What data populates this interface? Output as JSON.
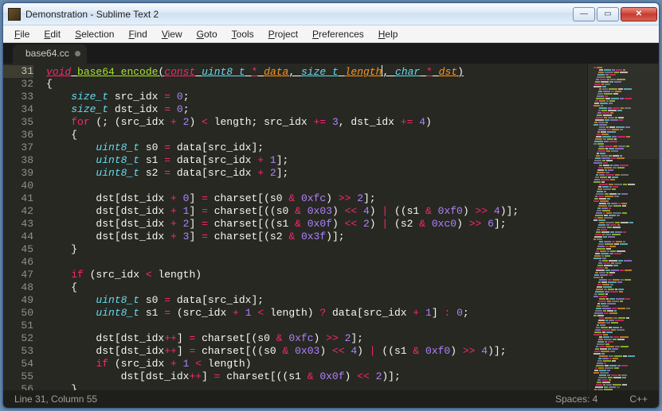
{
  "window": {
    "title": "Demonstration - Sublime Text 2"
  },
  "win_buttons": {
    "min": "—",
    "max": "▭",
    "close": "✕"
  },
  "menu": [
    "File",
    "Edit",
    "Selection",
    "Find",
    "View",
    "Goto",
    "Tools",
    "Project",
    "Preferences",
    "Help"
  ],
  "tab": {
    "label": "base64.cc",
    "modified": true
  },
  "gutter": {
    "start": 31,
    "end": 56,
    "current": 31
  },
  "status": {
    "left": "Line 31, Column 55",
    "spaces": "Spaces: 4",
    "lang": "C++"
  },
  "code": [
    [
      [
        "kw",
        "void"
      ],
      [
        "punc",
        " "
      ],
      [
        "fn",
        "base64_encode"
      ],
      [
        "punc",
        "("
      ],
      [
        "kw",
        "const"
      ],
      [
        "punc",
        " "
      ],
      [
        "type",
        "uint8_t"
      ],
      [
        "punc",
        " "
      ],
      [
        "op",
        "*"
      ],
      [
        "punc",
        " "
      ],
      [
        "param",
        "data"
      ],
      [
        "punc",
        ", "
      ],
      [
        "type",
        "size_t"
      ],
      [
        "punc",
        " "
      ],
      [
        "param",
        "length"
      ],
      [
        "caret",
        ""
      ],
      [
        "punc",
        ", "
      ],
      [
        "type",
        "char"
      ],
      [
        "punc",
        " "
      ],
      [
        "op",
        "*"
      ],
      [
        "punc",
        " "
      ],
      [
        "param",
        "dst"
      ],
      [
        "punc",
        ")"
      ]
    ],
    [
      [
        "punc",
        "{"
      ]
    ],
    [
      [
        "punc",
        "    "
      ],
      [
        "type",
        "size_t"
      ],
      [
        "punc",
        " src_idx "
      ],
      [
        "op",
        "="
      ],
      [
        "punc",
        " "
      ],
      [
        "num",
        "0"
      ],
      [
        "punc",
        ";"
      ]
    ],
    [
      [
        "punc",
        "    "
      ],
      [
        "type",
        "size_t"
      ],
      [
        "punc",
        " dst_idx "
      ],
      [
        "op",
        "="
      ],
      [
        "punc",
        " "
      ],
      [
        "num",
        "0"
      ],
      [
        "punc",
        ";"
      ]
    ],
    [
      [
        "punc",
        "    "
      ],
      [
        "kwp",
        "for"
      ],
      [
        "punc",
        " (; (src_idx "
      ],
      [
        "op",
        "+"
      ],
      [
        "punc",
        " "
      ],
      [
        "num",
        "2"
      ],
      [
        "punc",
        ") "
      ],
      [
        "op",
        "<"
      ],
      [
        "punc",
        " length; src_idx "
      ],
      [
        "op",
        "+="
      ],
      [
        "punc",
        " "
      ],
      [
        "num",
        "3"
      ],
      [
        "punc",
        ", dst_idx "
      ],
      [
        "op",
        "+="
      ],
      [
        "punc",
        " "
      ],
      [
        "num",
        "4"
      ],
      [
        "punc",
        ")"
      ]
    ],
    [
      [
        "punc",
        "    {"
      ]
    ],
    [
      [
        "punc",
        "        "
      ],
      [
        "type",
        "uint8_t"
      ],
      [
        "punc",
        " s0 "
      ],
      [
        "op",
        "="
      ],
      [
        "punc",
        " data[src_idx];"
      ]
    ],
    [
      [
        "punc",
        "        "
      ],
      [
        "type",
        "uint8_t"
      ],
      [
        "punc",
        " s1 "
      ],
      [
        "op",
        "="
      ],
      [
        "punc",
        " data[src_idx "
      ],
      [
        "op",
        "+"
      ],
      [
        "punc",
        " "
      ],
      [
        "num",
        "1"
      ],
      [
        "punc",
        "];"
      ]
    ],
    [
      [
        "punc",
        "        "
      ],
      [
        "type",
        "uint8_t"
      ],
      [
        "punc",
        " s2 "
      ],
      [
        "op",
        "="
      ],
      [
        "punc",
        " data[src_idx "
      ],
      [
        "op",
        "+"
      ],
      [
        "punc",
        " "
      ],
      [
        "num",
        "2"
      ],
      [
        "punc",
        "];"
      ]
    ],
    [
      [
        "punc",
        " "
      ]
    ],
    [
      [
        "punc",
        "        dst[dst_idx "
      ],
      [
        "op",
        "+"
      ],
      [
        "punc",
        " "
      ],
      [
        "num",
        "0"
      ],
      [
        "punc",
        "] "
      ],
      [
        "op",
        "="
      ],
      [
        "punc",
        " charset[(s0 "
      ],
      [
        "op",
        "&"
      ],
      [
        "punc",
        " "
      ],
      [
        "num",
        "0xfc"
      ],
      [
        "punc",
        ") "
      ],
      [
        "op",
        ">>"
      ],
      [
        "punc",
        " "
      ],
      [
        "num",
        "2"
      ],
      [
        "punc",
        "];"
      ]
    ],
    [
      [
        "punc",
        "        dst[dst_idx "
      ],
      [
        "op",
        "+"
      ],
      [
        "punc",
        " "
      ],
      [
        "num",
        "1"
      ],
      [
        "punc",
        "] "
      ],
      [
        "op",
        "="
      ],
      [
        "punc",
        " charset[((s0 "
      ],
      [
        "op",
        "&"
      ],
      [
        "punc",
        " "
      ],
      [
        "num",
        "0x03"
      ],
      [
        "punc",
        ") "
      ],
      [
        "op",
        "<<"
      ],
      [
        "punc",
        " "
      ],
      [
        "num",
        "4"
      ],
      [
        "punc",
        ") "
      ],
      [
        "op",
        "|"
      ],
      [
        "punc",
        " ((s1 "
      ],
      [
        "op",
        "&"
      ],
      [
        "punc",
        " "
      ],
      [
        "num",
        "0xf0"
      ],
      [
        "punc",
        ") "
      ],
      [
        "op",
        ">>"
      ],
      [
        "punc",
        " "
      ],
      [
        "num",
        "4"
      ],
      [
        "punc",
        ")];"
      ]
    ],
    [
      [
        "punc",
        "        dst[dst_idx "
      ],
      [
        "op",
        "+"
      ],
      [
        "punc",
        " "
      ],
      [
        "num",
        "2"
      ],
      [
        "punc",
        "] "
      ],
      [
        "op",
        "="
      ],
      [
        "punc",
        " charset[((s1 "
      ],
      [
        "op",
        "&"
      ],
      [
        "punc",
        " "
      ],
      [
        "num",
        "0x0f"
      ],
      [
        "punc",
        ") "
      ],
      [
        "op",
        "<<"
      ],
      [
        "punc",
        " "
      ],
      [
        "num",
        "2"
      ],
      [
        "punc",
        ") "
      ],
      [
        "op",
        "|"
      ],
      [
        "punc",
        " (s2 "
      ],
      [
        "op",
        "&"
      ],
      [
        "punc",
        " "
      ],
      [
        "num",
        "0xc0"
      ],
      [
        "punc",
        ") "
      ],
      [
        "op",
        ">>"
      ],
      [
        "punc",
        " "
      ],
      [
        "num",
        "6"
      ],
      [
        "punc",
        "];"
      ]
    ],
    [
      [
        "punc",
        "        dst[dst_idx "
      ],
      [
        "op",
        "+"
      ],
      [
        "punc",
        " "
      ],
      [
        "num",
        "3"
      ],
      [
        "punc",
        "] "
      ],
      [
        "op",
        "="
      ],
      [
        "punc",
        " charset[(s2 "
      ],
      [
        "op",
        "&"
      ],
      [
        "punc",
        " "
      ],
      [
        "num",
        "0x3f"
      ],
      [
        "punc",
        ")];"
      ]
    ],
    [
      [
        "punc",
        "    }"
      ]
    ],
    [
      [
        "punc",
        " "
      ]
    ],
    [
      [
        "punc",
        "    "
      ],
      [
        "kwp",
        "if"
      ],
      [
        "punc",
        " (src_idx "
      ],
      [
        "op",
        "<"
      ],
      [
        "punc",
        " length)"
      ]
    ],
    [
      [
        "punc",
        "    {"
      ]
    ],
    [
      [
        "punc",
        "        "
      ],
      [
        "type",
        "uint8_t"
      ],
      [
        "punc",
        " s0 "
      ],
      [
        "op",
        "="
      ],
      [
        "punc",
        " data[src_idx];"
      ]
    ],
    [
      [
        "punc",
        "        "
      ],
      [
        "type",
        "uint8_t"
      ],
      [
        "punc",
        " s1 "
      ],
      [
        "op",
        "="
      ],
      [
        "punc",
        " (src_idx "
      ],
      [
        "op",
        "+"
      ],
      [
        "punc",
        " "
      ],
      [
        "num",
        "1"
      ],
      [
        "punc",
        " "
      ],
      [
        "op",
        "<"
      ],
      [
        "punc",
        " length) "
      ],
      [
        "op",
        "?"
      ],
      [
        "punc",
        " data[src_idx "
      ],
      [
        "op",
        "+"
      ],
      [
        "punc",
        " "
      ],
      [
        "num",
        "1"
      ],
      [
        "punc",
        "] "
      ],
      [
        "op",
        ":"
      ],
      [
        "punc",
        " "
      ],
      [
        "num",
        "0"
      ],
      [
        "punc",
        ";"
      ]
    ],
    [
      [
        "punc",
        " "
      ]
    ],
    [
      [
        "punc",
        "        dst[dst_idx"
      ],
      [
        "op",
        "++"
      ],
      [
        "punc",
        "] "
      ],
      [
        "op",
        "="
      ],
      [
        "punc",
        " charset[(s0 "
      ],
      [
        "op",
        "&"
      ],
      [
        "punc",
        " "
      ],
      [
        "num",
        "0xfc"
      ],
      [
        "punc",
        ") "
      ],
      [
        "op",
        ">>"
      ],
      [
        "punc",
        " "
      ],
      [
        "num",
        "2"
      ],
      [
        "punc",
        "];"
      ]
    ],
    [
      [
        "punc",
        "        dst[dst_idx"
      ],
      [
        "op",
        "++"
      ],
      [
        "punc",
        "] "
      ],
      [
        "op",
        "="
      ],
      [
        "punc",
        " charset[((s0 "
      ],
      [
        "op",
        "&"
      ],
      [
        "punc",
        " "
      ],
      [
        "num",
        "0x03"
      ],
      [
        "punc",
        ") "
      ],
      [
        "op",
        "<<"
      ],
      [
        "punc",
        " "
      ],
      [
        "num",
        "4"
      ],
      [
        "punc",
        ") "
      ],
      [
        "op",
        "|"
      ],
      [
        "punc",
        " ((s1 "
      ],
      [
        "op",
        "&"
      ],
      [
        "punc",
        " "
      ],
      [
        "num",
        "0xf0"
      ],
      [
        "punc",
        ") "
      ],
      [
        "op",
        ">>"
      ],
      [
        "punc",
        " "
      ],
      [
        "num",
        "4"
      ],
      [
        "punc",
        ")];"
      ]
    ],
    [
      [
        "punc",
        "        "
      ],
      [
        "kwp",
        "if"
      ],
      [
        "punc",
        " (src_idx "
      ],
      [
        "op",
        "+"
      ],
      [
        "punc",
        " "
      ],
      [
        "num",
        "1"
      ],
      [
        "punc",
        " "
      ],
      [
        "op",
        "<"
      ],
      [
        "punc",
        " length)"
      ]
    ],
    [
      [
        "punc",
        "            dst[dst_idx"
      ],
      [
        "op",
        "++"
      ],
      [
        "punc",
        "] "
      ],
      [
        "op",
        "="
      ],
      [
        "punc",
        " charset[((s1 "
      ],
      [
        "op",
        "&"
      ],
      [
        "punc",
        " "
      ],
      [
        "num",
        "0x0f"
      ],
      [
        "punc",
        ") "
      ],
      [
        "op",
        "<<"
      ],
      [
        "punc",
        " "
      ],
      [
        "num",
        "2"
      ],
      [
        "punc",
        ")];"
      ]
    ],
    [
      [
        "punc",
        "    }"
      ]
    ]
  ],
  "minimap_colors": [
    "#f92672",
    "#66d9ef",
    "#a6e22e",
    "#fd971f",
    "#ae81ff",
    "#f8f8f2",
    "#8f908a"
  ]
}
